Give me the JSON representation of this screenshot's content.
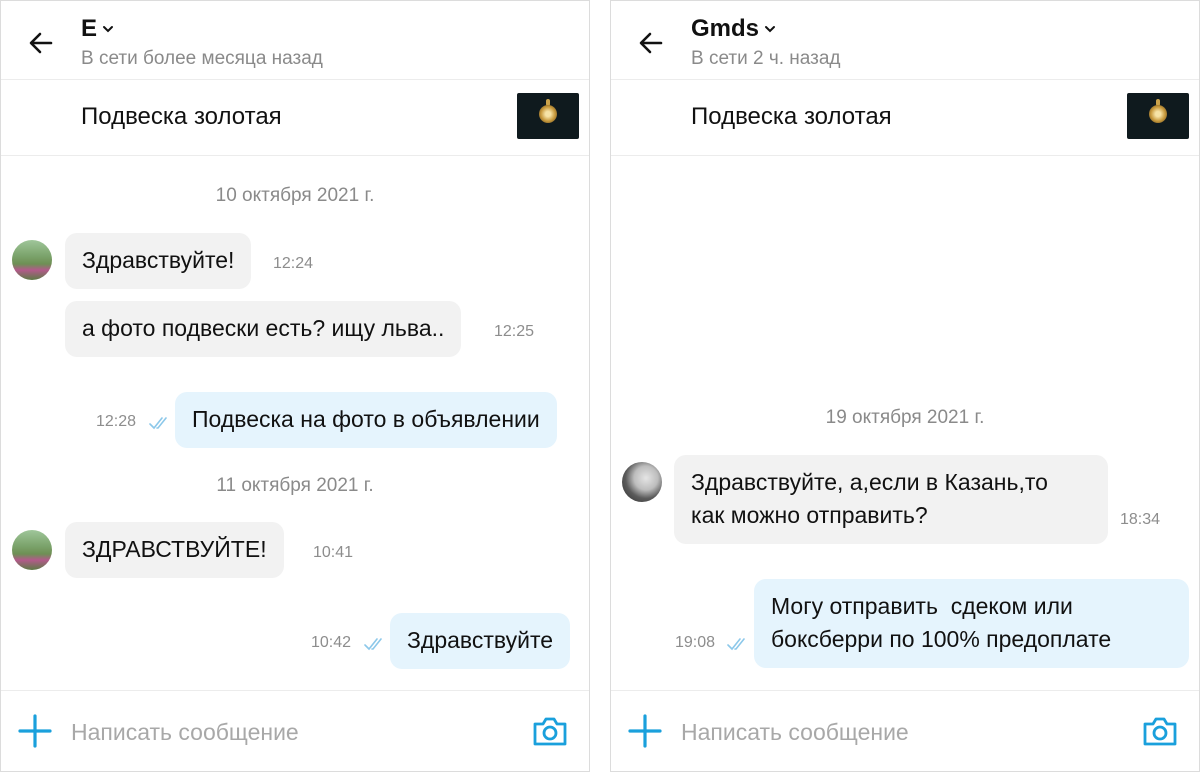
{
  "colors": {
    "accent": "#1aa0dc",
    "incoming_bubble": "#f2f2f2",
    "outgoing_bubble": "#e5f4fd",
    "muted_text": "#8a8a8a"
  },
  "left_chat": {
    "contact_name": "E",
    "status": "В сети более месяца назад",
    "listing_title": "Подвеска золотая",
    "date_1": "10 октября 2021 г.",
    "date_2": "11 октября 2021 г.",
    "messages": [
      {
        "direction": "incoming",
        "text": "Здравствуйте!",
        "time": "12:24"
      },
      {
        "direction": "incoming",
        "text": "а фото подвески есть? ищу льва..",
        "time": "12:25"
      },
      {
        "direction": "outgoing",
        "text": "Подвеска на фото в объявлении",
        "time": "12:28"
      },
      {
        "direction": "incoming",
        "text": "ЗДРАВСТВУЙТЕ!",
        "time": "10:41"
      },
      {
        "direction": "outgoing",
        "text": "Здравствуйте",
        "time": "10:42"
      }
    ],
    "composer_placeholder": "Написать сообщение"
  },
  "right_chat": {
    "contact_name": "Gmds",
    "status": "В сети 2 ч. назад",
    "listing_title": "Подвеска золотая",
    "date_1": "19 октября 2021 г.",
    "messages": [
      {
        "direction": "incoming",
        "line1": "Здравствуйте, а,если в Казань,то",
        "line2": "как можно отправить?",
        "time": "18:34"
      },
      {
        "direction": "outgoing",
        "line1": "Могу отправить  сдеком или",
        "line2": "боксберри по 100% предоплате",
        "time": "19:08"
      }
    ],
    "composer_placeholder": "Написать сообщение"
  },
  "icons": [
    "arrow-left-icon",
    "chevron-down-icon",
    "double-check-icon",
    "plus-icon",
    "camera-icon"
  ]
}
